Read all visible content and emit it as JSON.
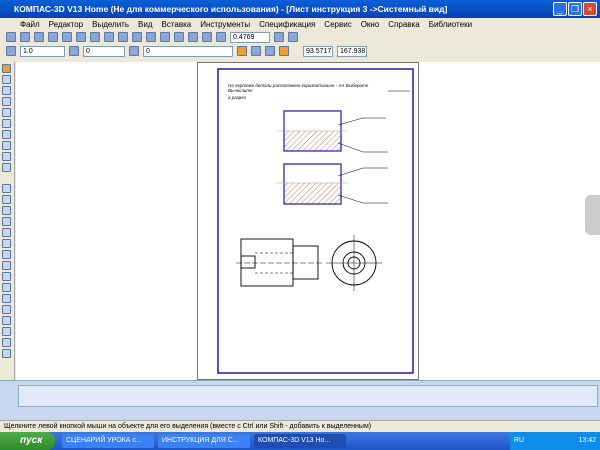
{
  "window": {
    "title": "КОМПАС-3D V13 Home (Не для коммерческого использования) - [Лист инструкция 3 ->Системный вид]"
  },
  "menu": [
    "Файл",
    "Редактор",
    "Выделить",
    "Вид",
    "Вставка",
    "Инструменты",
    "Спецификация",
    "Сервис",
    "Окно",
    "Справка",
    "Библиотеки"
  ],
  "toolbar": {
    "zoom": "0.4769",
    "line_width": "1.0",
    "layer": "0",
    "style": "0",
    "coord_x": "93.5717",
    "coord_y": "167.938"
  },
  "sheet": {
    "line1": "На чертеже детали расположено горизонтально - АА Выберите Вычислите",
    "line2": "а разрез"
  },
  "status": "Щелкните левой кнопкой мыши на объекте для его выделения (вместе с Ctrl или Shift - добавить к выделенным)",
  "taskbar": {
    "start": "пуск",
    "tasks": [
      "СЦЕНАРИЙ УРОКА с...",
      "ИНСТРУКЦИЯ ДЛЯ С...",
      "КОМПАС-3D V13 Ho..."
    ],
    "lang": "RU",
    "clock": "13:42"
  }
}
